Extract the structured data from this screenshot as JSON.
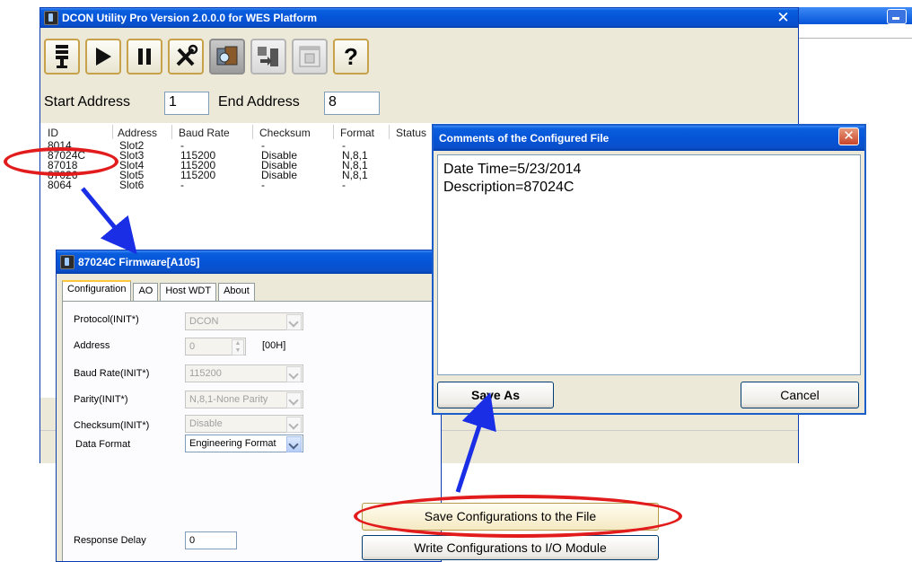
{
  "main": {
    "title": "DCON Utility Pro Version 2.0.0.0 for WES Platform",
    "toolbar_icons": [
      "antenna-icon",
      "play-icon",
      "pause-icon",
      "tools-icon",
      "search-module-icon",
      "download-icon",
      "terminal-icon",
      "help-icon"
    ],
    "help_label": "?",
    "start_address_label": "Start Address",
    "start_address_value": "1",
    "end_address_label": "End Address",
    "end_address_value": "8",
    "columns": [
      "ID",
      "Address",
      "Baud Rate",
      "Checksum",
      "Format",
      "Status"
    ],
    "rows": [
      {
        "id": "8014",
        "address": "Slot2",
        "baud": "-",
        "checksum": "-",
        "format": "-"
      },
      {
        "id": "87024C",
        "address": "Slot3",
        "baud": "115200",
        "checksum": "Disable",
        "format": "N,8,1"
      },
      {
        "id": "87018",
        "address": "Slot4",
        "baud": "115200",
        "checksum": "Disable",
        "format": "N,8,1"
      },
      {
        "id": "87026",
        "address": "Slot5",
        "baud": "115200",
        "checksum": "Disable",
        "format": "N,8,1"
      },
      {
        "id": "8064",
        "address": "Slot6",
        "baud": "-",
        "checksum": "-",
        "format": "-"
      }
    ],
    "close_glyph": "✕"
  },
  "firmware": {
    "title": "87024C Firmware[A105]",
    "tabs": [
      "Configuration",
      "AO",
      "Host WDT",
      "About"
    ],
    "protocol_label": "Protocol(INIT*)",
    "protocol_value": "DCON",
    "address_label": "Address",
    "address_value": "0",
    "address_unit": "[00H]",
    "baud_label": "Baud Rate(INIT*)",
    "baud_value": "115200",
    "parity_label": "Parity(INIT*)",
    "parity_value": "N,8,1-None Parity",
    "checksum_label": "Checksum(INIT*)",
    "checksum_value": "Disable",
    "data_format_label": "Data Format",
    "data_format_value": "Engineering Format",
    "response_delay_label": "Response Delay",
    "response_delay_value": "0",
    "save_config_label": "Save Configurations to the File",
    "write_config_label": "Write Configurations to I/O Module"
  },
  "comments": {
    "title": "Comments of the Configured File",
    "line1": "Date Time=5/23/2014",
    "line2": "Description=87024C",
    "save_as_label": "Save As",
    "cancel_label": "Cancel",
    "close_glyph": "✕"
  },
  "colors": {
    "annotation_red": "#e21c1c",
    "annotation_blue": "#1a2ee6",
    "xp_blue": "#0554d8"
  }
}
